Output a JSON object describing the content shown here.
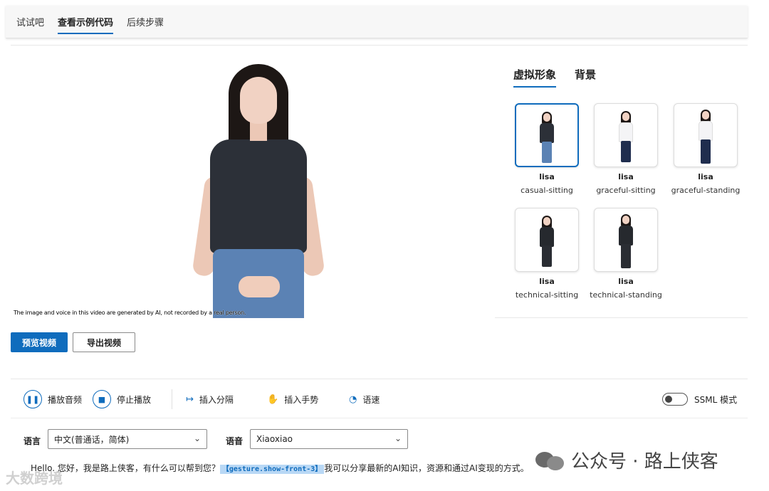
{
  "top_tabs": [
    {
      "label": "试试吧"
    },
    {
      "label": "查看示例代码"
    },
    {
      "label": "后续步骤"
    }
  ],
  "video": {
    "disclaimer": "The image and voice in this video are generated by AI, not recorded by a real person."
  },
  "panel_tabs": [
    {
      "label": "虚拟形象"
    },
    {
      "label": "背景"
    }
  ],
  "avatars": [
    {
      "name": "lisa",
      "pose": "casual-sitting",
      "selected": true
    },
    {
      "name": "lisa",
      "pose": "graceful-sitting",
      "selected": false
    },
    {
      "name": "lisa",
      "pose": "graceful-standing",
      "selected": false
    },
    {
      "name": "lisa",
      "pose": "technical-sitting",
      "selected": false
    },
    {
      "name": "lisa",
      "pose": "technical-standing",
      "selected": false
    }
  ],
  "buttons": {
    "preview": "预览视频",
    "export": "导出视频"
  },
  "toolbar": {
    "play_audio": "播放音频",
    "stop_play": "停止播放",
    "insert_pause": "插入分隔",
    "insert_gesture": "插入手势",
    "speed": "语速",
    "ssml_mode": "SSML 模式"
  },
  "fields": {
    "language_label": "语言",
    "language_value": "中文(普通话，简体)",
    "voice_label": "语音",
    "voice_value": "Xiaoxiao"
  },
  "script_text": {
    "before": "Hello. 您好，我是路上侠客，有什么可以帮到您？",
    "gesture_tag": "【gesture.show-front-3】",
    "after": "我可以分享最新的AI知识，资源和通过AI变现的方式。"
  },
  "watermark": {
    "right": "公众号 · 路上侠客",
    "left": "大数跨境"
  },
  "colors": {
    "accent": "#0f6cbd"
  }
}
